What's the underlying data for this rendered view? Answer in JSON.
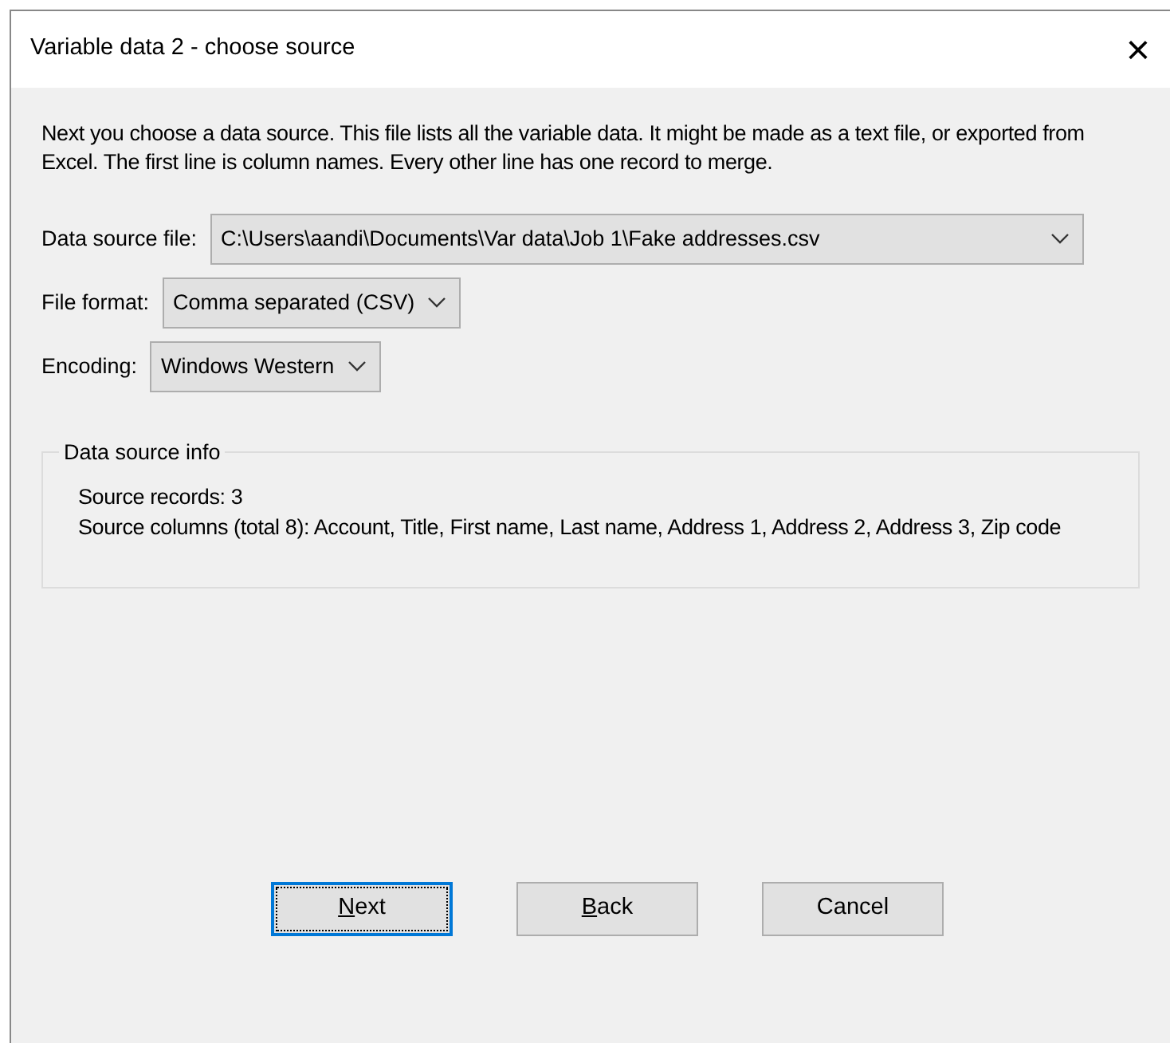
{
  "window": {
    "title": "Variable data 2 - choose source",
    "close": "×"
  },
  "intro": "Next you choose a data source. This file lists all the variable data. It might be made as a text file, or exported from Excel. The first line is column names. Every other line has one record to merge.",
  "fields": [
    {
      "label": "Data source file:",
      "value": "C:\\Users\\aandi\\Documents\\Var data\\Job 1\\Fake addresses.csv",
      "kind": "wide"
    },
    {
      "label": "File format:",
      "value": "Comma separated (CSV)",
      "kind": "fit"
    },
    {
      "label": "Encoding:",
      "value": "Windows Western",
      "kind": "fit"
    }
  ],
  "info": {
    "title": "Data source info",
    "lines": [
      "Source records: 3",
      "Source columns (total 8): Account, Title, First name, Last name, Address 1, Address 2, Address 3, Zip code"
    ]
  },
  "buttons": [
    {
      "access_key": "N",
      "label_rest": "ext",
      "focused": true
    },
    {
      "access_key": "B",
      "label_rest": "ack",
      "focused": false
    },
    {
      "label_rest": "Cancel",
      "focused": false
    }
  ]
}
